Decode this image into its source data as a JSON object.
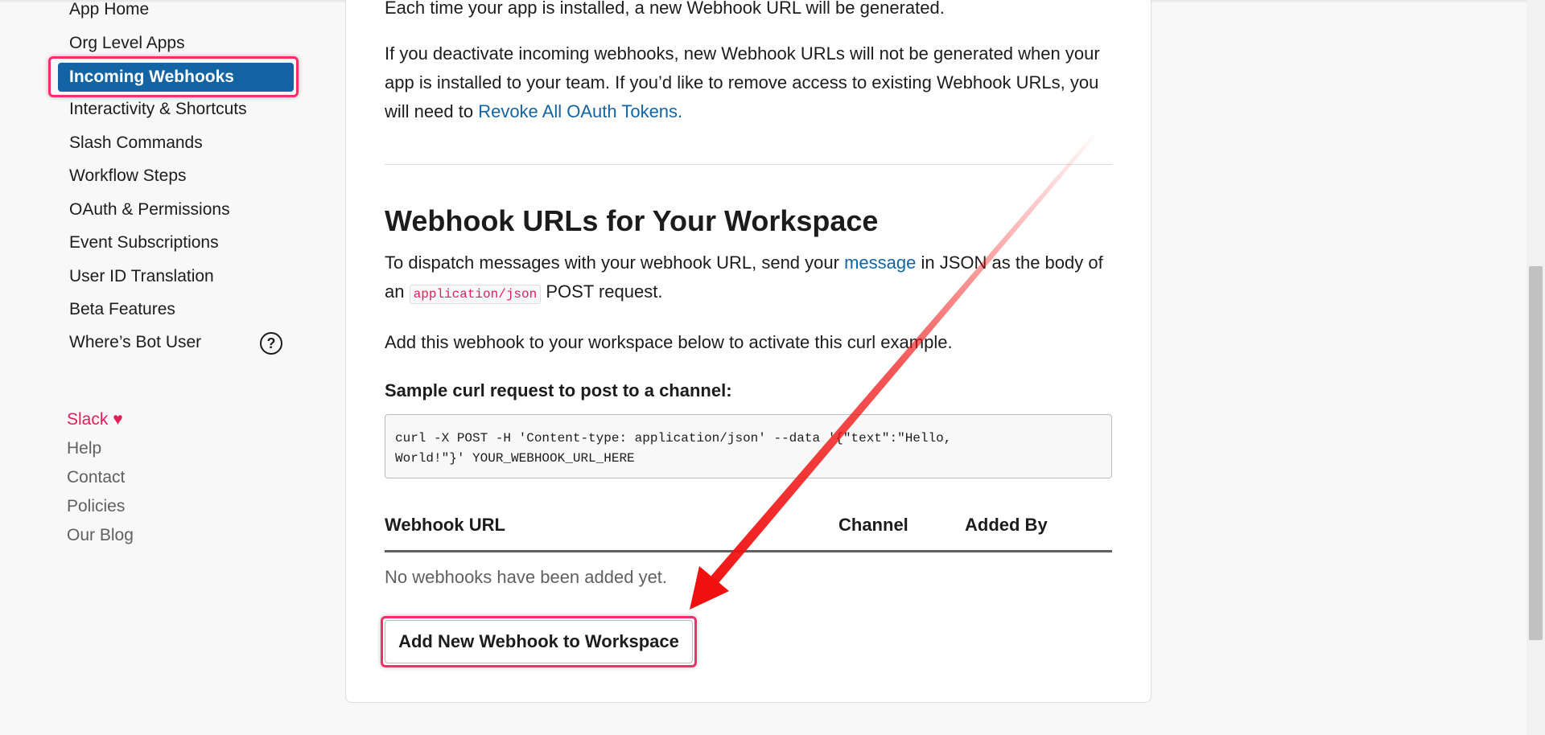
{
  "sidebar": {
    "items": [
      "App Home",
      "Org Level Apps",
      "Incoming Webhooks",
      "Interactivity & Shortcuts",
      "Slash Commands",
      "Workflow Steps",
      "OAuth & Permissions",
      "Event Subscriptions",
      "User ID Translation",
      "Beta Features",
      "Where’s Bot User"
    ],
    "active": "Incoming Webhooks",
    "help_icon": "?",
    "footer": {
      "slack": "Slack",
      "heart": "♥",
      "help": "Help",
      "contact": "Contact",
      "policies": "Policies",
      "blog": "Our Blog"
    }
  },
  "main": {
    "intro": "Each time your app is installed, a new Webhook URL will be generated.",
    "deactivate_text": "If you deactivate incoming webhooks, new Webhook URLs will not be generated when your app is installed to your team. If you’d like to remove access to existing Webhook URLs, you will need to",
    "revoke_link": "Revoke All OAuth Tokens.",
    "heading": "Webhook URLs for Your Workspace",
    "dispatch_pre": "To dispatch messages with your webhook URL, send your",
    "message_link": "message",
    "dispatch_mid": "in JSON as the body of an",
    "content_type": "application/json",
    "dispatch_post": "POST request.",
    "add_text": "Add this webhook to your workspace below to activate this curl example.",
    "sample_label": "Sample curl request to post to a channel:",
    "code": "curl -X POST -H 'Content-type: application/json' --data '{\"text\":\"Hello,\nWorld!\"}' YOUR_WEBHOOK_URL_HERE",
    "table": {
      "headers": [
        "Webhook URL",
        "Channel",
        "Added By"
      ],
      "empty": "No webhooks have been added yet."
    },
    "add_button": "Add New Webhook to Workspace"
  },
  "colors": {
    "accent": "#1264a3",
    "highlight": "#f0306a",
    "arrow": "#f01010"
  }
}
